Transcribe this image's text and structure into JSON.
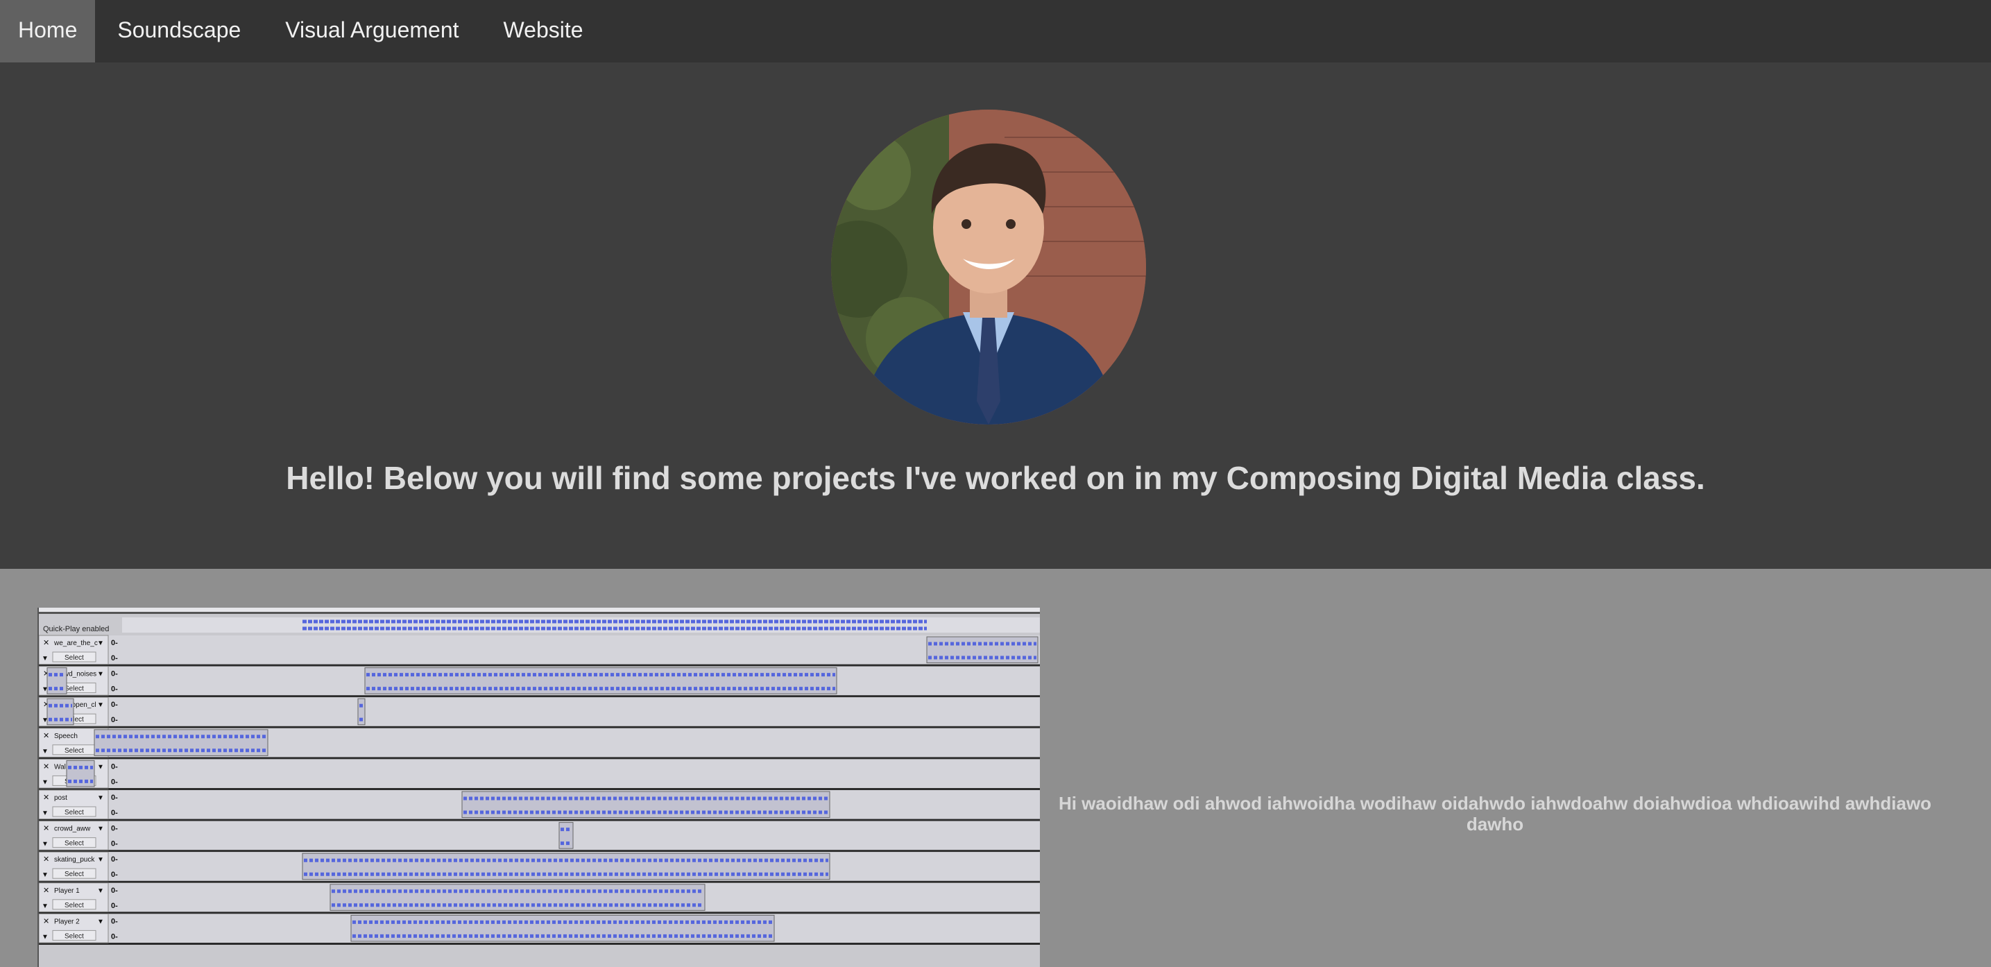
{
  "nav": {
    "items": [
      {
        "label": "Home",
        "active": true
      },
      {
        "label": "Soundscape",
        "active": false
      },
      {
        "label": "Visual Arguement",
        "active": false
      },
      {
        "label": "Website",
        "active": false
      }
    ]
  },
  "hero": {
    "title": "Hello! Below you will find some projects I've worked on in my Composing Digital Media class."
  },
  "project": {
    "quickplay_label": "Quick-Play enabled",
    "select_label": "Select",
    "gain_label": "0-",
    "tracks": [
      {
        "name": "we_are_the_c"
      },
      {
        "name": "crowd_noises"
      },
      {
        "name": "door_open_cl"
      },
      {
        "name": "Speech"
      },
      {
        "name": "Walking"
      },
      {
        "name": "post"
      },
      {
        "name": "crowd_aww"
      },
      {
        "name": "skating_puck"
      },
      {
        "name": "Player 1"
      },
      {
        "name": "Player 2"
      }
    ],
    "caption": "Hi waoidhaw odi ahwod iahwoidha wodihaw oidahwdo iahwdoahw doiahwdioa whdioawihd awhdiawo dawho"
  },
  "colors": {
    "nav_bg": "#333333",
    "nav_active": "#616161",
    "hero_bg": "#3e3e3e",
    "section_bg": "#8f8f8f",
    "waveform": "#5566dd"
  }
}
